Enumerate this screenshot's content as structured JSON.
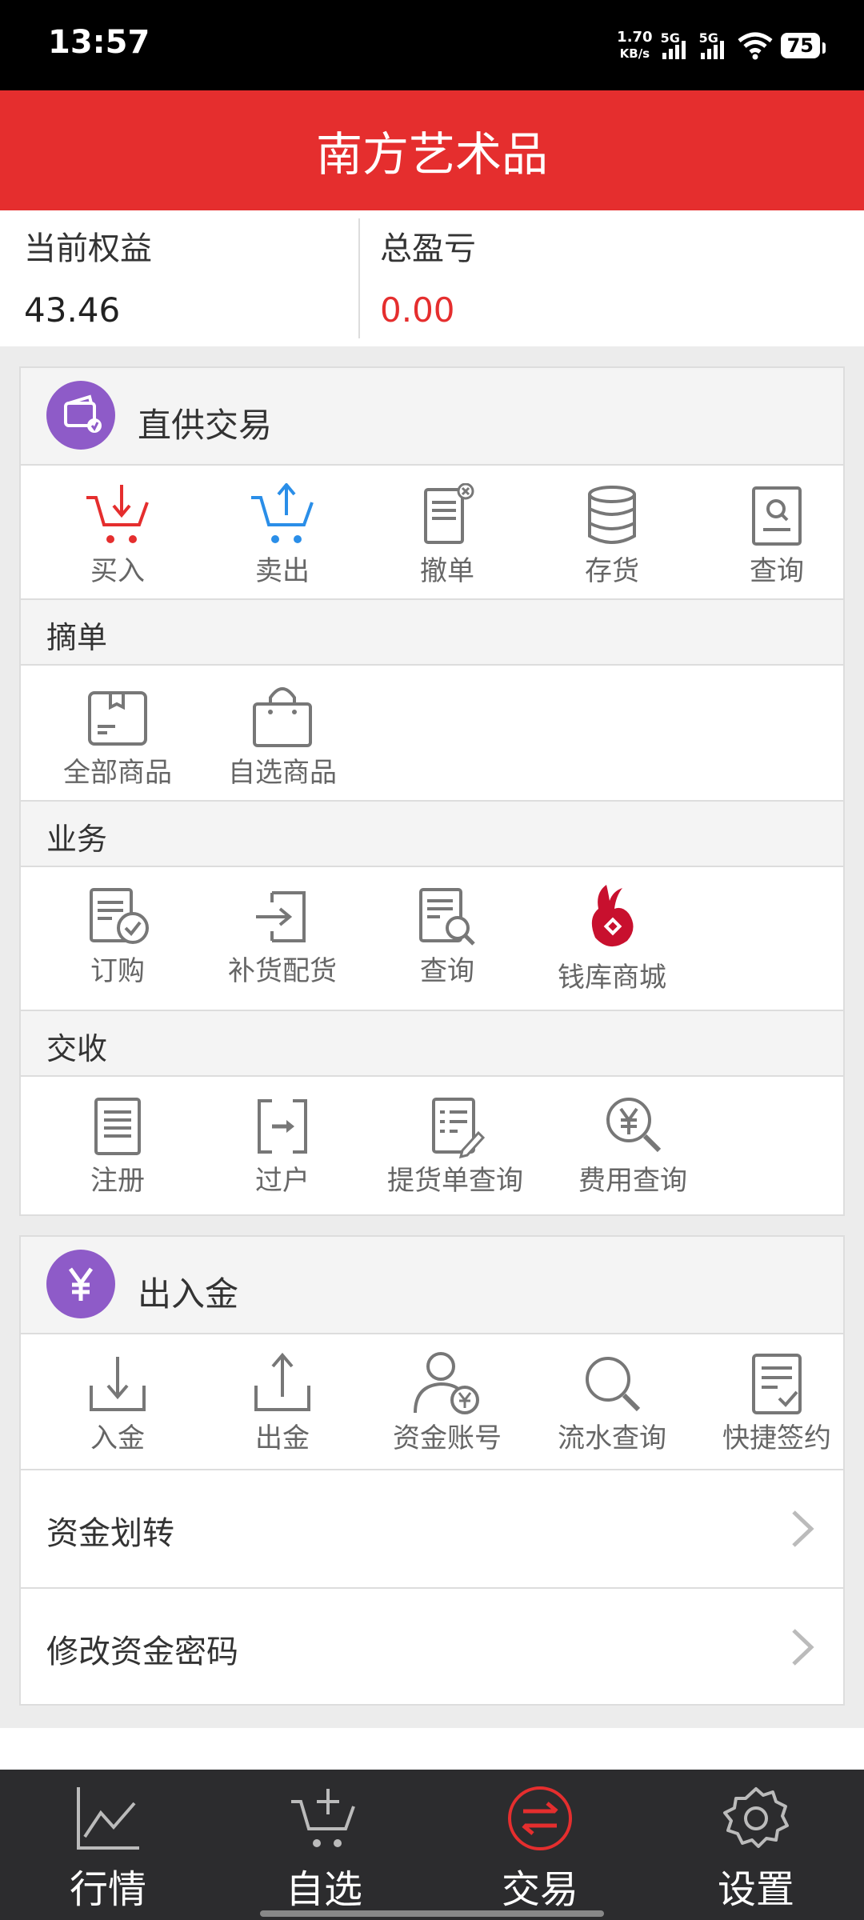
{
  "status_bar": {
    "time": "13:57",
    "speed_value": "1.70",
    "speed_unit": "KB/s",
    "net1": "5G",
    "net2": "5G",
    "battery": "75"
  },
  "header": {
    "title": "南方艺术品"
  },
  "summary": {
    "equity_label": "当前权益",
    "equity_value": "43.46",
    "pnl_label": "总盈亏",
    "pnl_value": "0.00",
    "pnl_color": "#e52e2e"
  },
  "trade_panel": {
    "title": "直供交易",
    "actions": [
      {
        "label": "买入",
        "icon": "buy-cart-icon"
      },
      {
        "label": "卖出",
        "icon": "sell-cart-icon"
      },
      {
        "label": "撤单",
        "icon": "cancel-order-icon"
      },
      {
        "label": "存货",
        "icon": "inventory-icon"
      },
      {
        "label": "查询",
        "icon": "query-icon"
      }
    ],
    "pick_section": {
      "title": "摘单",
      "items": [
        {
          "label": "全部商品",
          "icon": "box-icon"
        },
        {
          "label": "自选商品",
          "icon": "shopping-bag-icon"
        }
      ]
    },
    "business_section": {
      "title": "业务",
      "items": [
        {
          "label": "订购",
          "icon": "order-check-icon"
        },
        {
          "label": "补货配货",
          "icon": "restock-icon"
        },
        {
          "label": "查询",
          "icon": "doc-search-icon"
        },
        {
          "label": "钱库商城",
          "icon": "qianku-logo-icon"
        }
      ]
    },
    "delivery_section": {
      "title": "交收",
      "items": [
        {
          "label": "注册",
          "icon": "register-doc-icon"
        },
        {
          "label": "过户",
          "icon": "transfer-icon"
        },
        {
          "label": "提货单查询",
          "icon": "bill-edit-icon"
        },
        {
          "label": "费用查询",
          "icon": "fee-search-icon"
        }
      ]
    }
  },
  "funds_panel": {
    "title": "出入金",
    "actions": [
      {
        "label": "入金",
        "icon": "deposit-icon"
      },
      {
        "label": "出金",
        "icon": "withdraw-icon"
      },
      {
        "label": "资金账号",
        "icon": "fund-account-icon"
      },
      {
        "label": "流水查询",
        "icon": "flow-search-icon"
      },
      {
        "label": "快捷签约",
        "icon": "quick-sign-icon"
      }
    ],
    "rows": [
      {
        "label": "资金划转"
      },
      {
        "label": "修改资金密码"
      }
    ]
  },
  "bottom_nav": {
    "items": [
      {
        "label": "行情",
        "icon": "chart-icon"
      },
      {
        "label": "自选",
        "icon": "cart-add-icon"
      },
      {
        "label": "交易",
        "icon": "exchange-icon",
        "active": true
      },
      {
        "label": "设置",
        "icon": "gear-icon"
      }
    ],
    "active_color": "#e52e2e"
  },
  "colors": {
    "brand": "#e52e2e",
    "panel_icon": "#8e5bc8",
    "sell_blue": "#2a8ee8"
  }
}
